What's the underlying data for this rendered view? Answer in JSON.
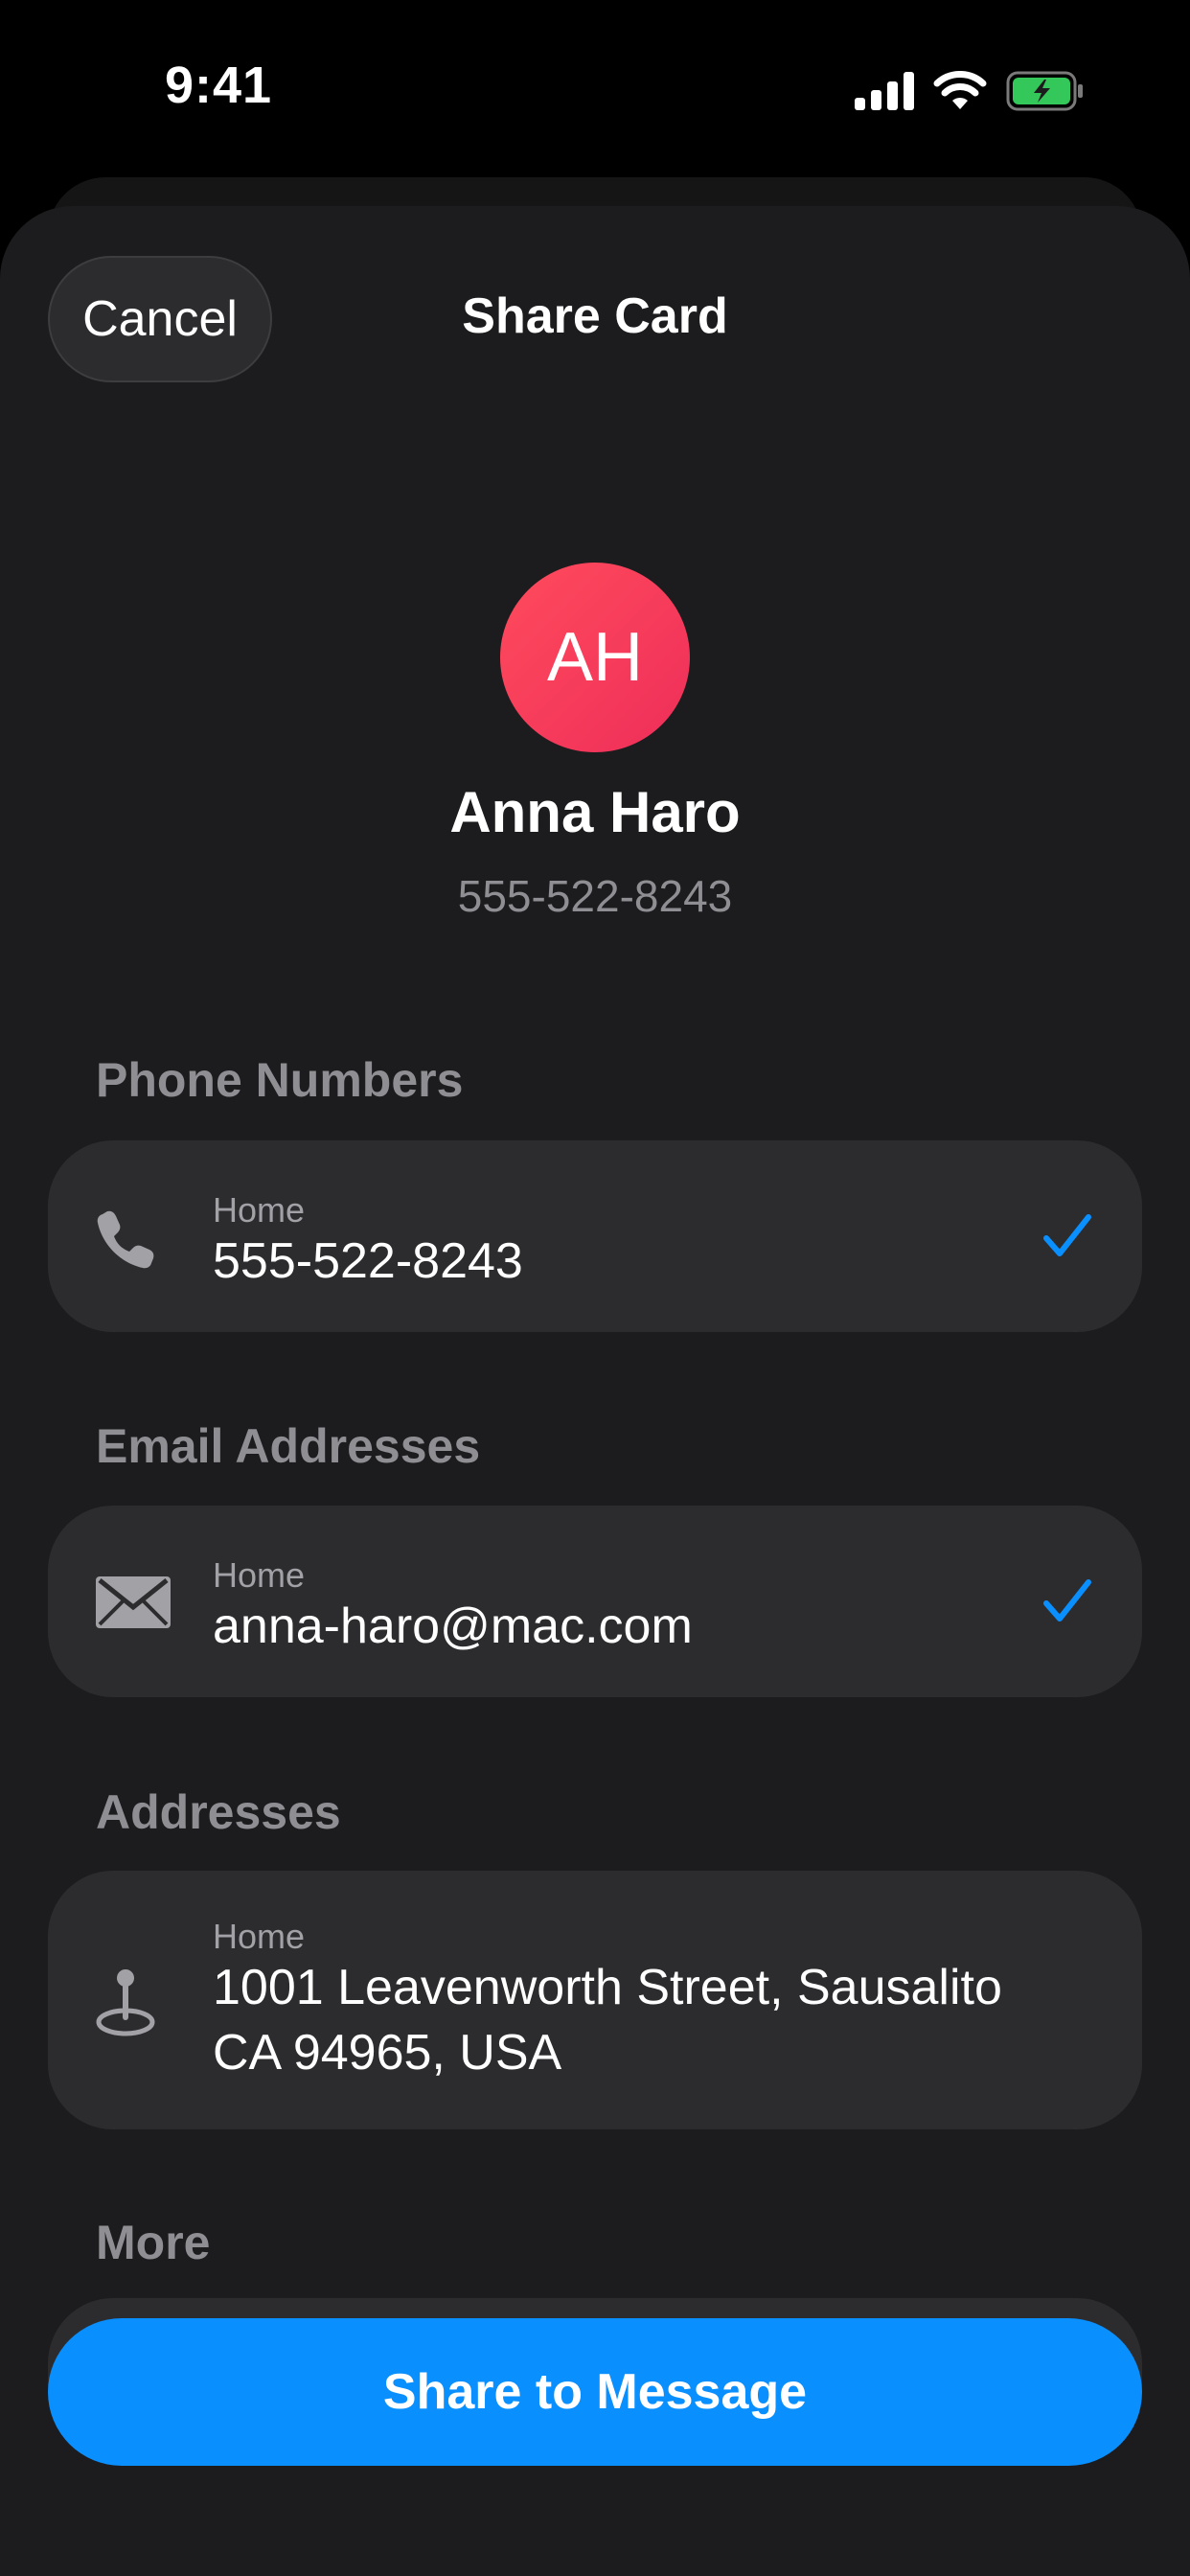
{
  "status_bar": {
    "time": "9:41",
    "icons": [
      "cellular-signal-icon",
      "wifi-icon",
      "battery-charging-icon"
    ]
  },
  "header": {
    "cancel_label": "Cancel",
    "title": "Share Card"
  },
  "contact": {
    "initials": "AH",
    "name": "Anna Haro",
    "phone": "555-522-8243"
  },
  "sections": {
    "phone_numbers": {
      "header": "Phone Numbers",
      "label": "Home",
      "value": "555-522-8243",
      "icon": "phone-icon",
      "selected": true
    },
    "email_addresses": {
      "header": "Email Addresses",
      "label": "Home",
      "value": "anna-haro@mac.com",
      "icon": "envelope-icon",
      "selected": true
    },
    "addresses": {
      "header": "Addresses",
      "label": "Home",
      "line1": "1001  Leavenworth Street, Sausalito",
      "line2": "CA 94965, USA",
      "icon": "location-pin-icon"
    },
    "more": {
      "header": "More"
    }
  },
  "share_button_label": "Share to Message",
  "colors": {
    "accent": "#0a8fff",
    "avatar": "#f53a57",
    "sheet_background": "#1c1c1e",
    "card_background": "#2c2c2e",
    "secondary_text": "#8e8e93"
  }
}
